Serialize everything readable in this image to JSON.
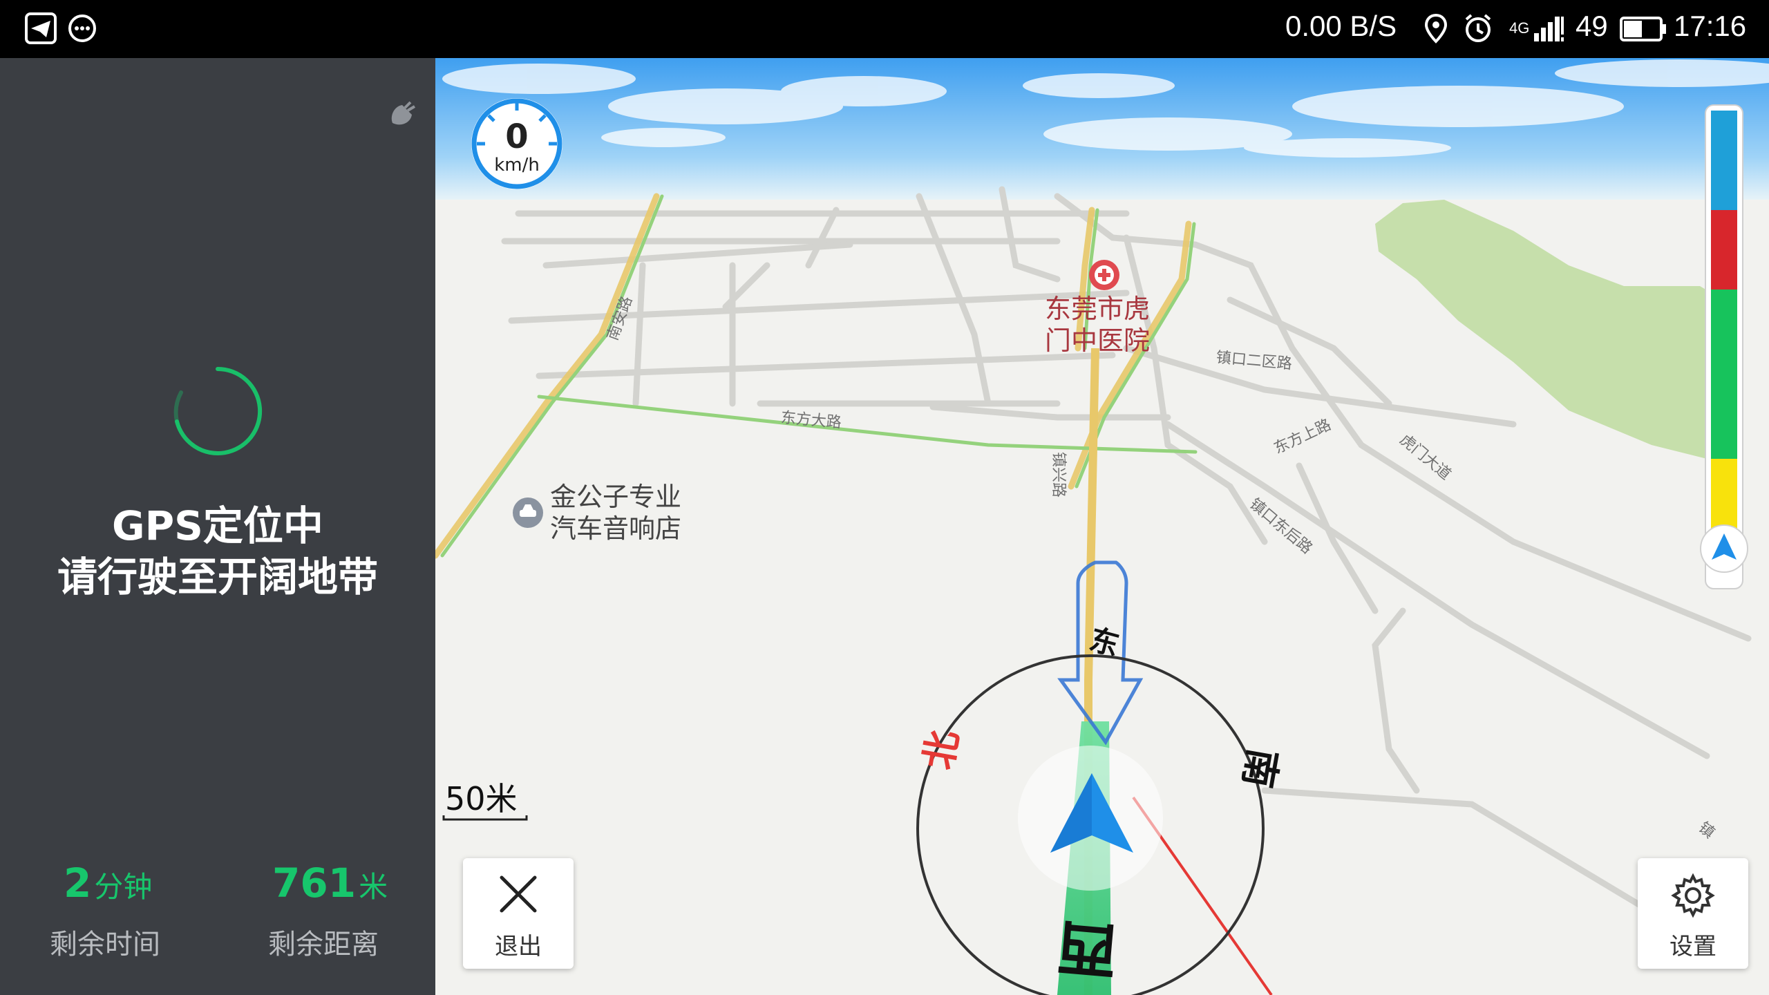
{
  "status_bar": {
    "net_speed": "0.00 B/S",
    "network": "4G",
    "battery": "49",
    "time": "17:16"
  },
  "left_panel": {
    "gps_line1": "GPS定位中",
    "gps_line2": "请行驶至开阔地带",
    "time_value": "2",
    "time_unit": "分钟",
    "time_label": "剩余时间",
    "distance_value": "761",
    "distance_unit": "米",
    "distance_label": "剩余距离"
  },
  "map": {
    "speed_value": "0",
    "speed_unit": "km/h",
    "scale_label": "50米",
    "poi_hospital_line1": "东莞市虎",
    "poi_hospital_line2": "门中医院",
    "poi_shop_line1": "金公子专业",
    "poi_shop_line2": "汽车音响店",
    "road_labels": [
      "东方大路",
      "镇兴路",
      "东方上路",
      "镇口二区路",
      "虎门大道",
      "南安路",
      "镇口东后路",
      "镇"
    ],
    "compass": {
      "east": "东",
      "west": "西",
      "south": "南",
      "north": "北"
    },
    "exit_label": "退出",
    "settings_label": "设置",
    "colors": {
      "traffic_blue": "#1fa0d8",
      "traffic_red": "#d8262c",
      "traffic_green": "#17c35c",
      "traffic_yellow": "#f8e20c",
      "route_green": "#4fd18a",
      "accent_green": "#17c66c"
    }
  }
}
